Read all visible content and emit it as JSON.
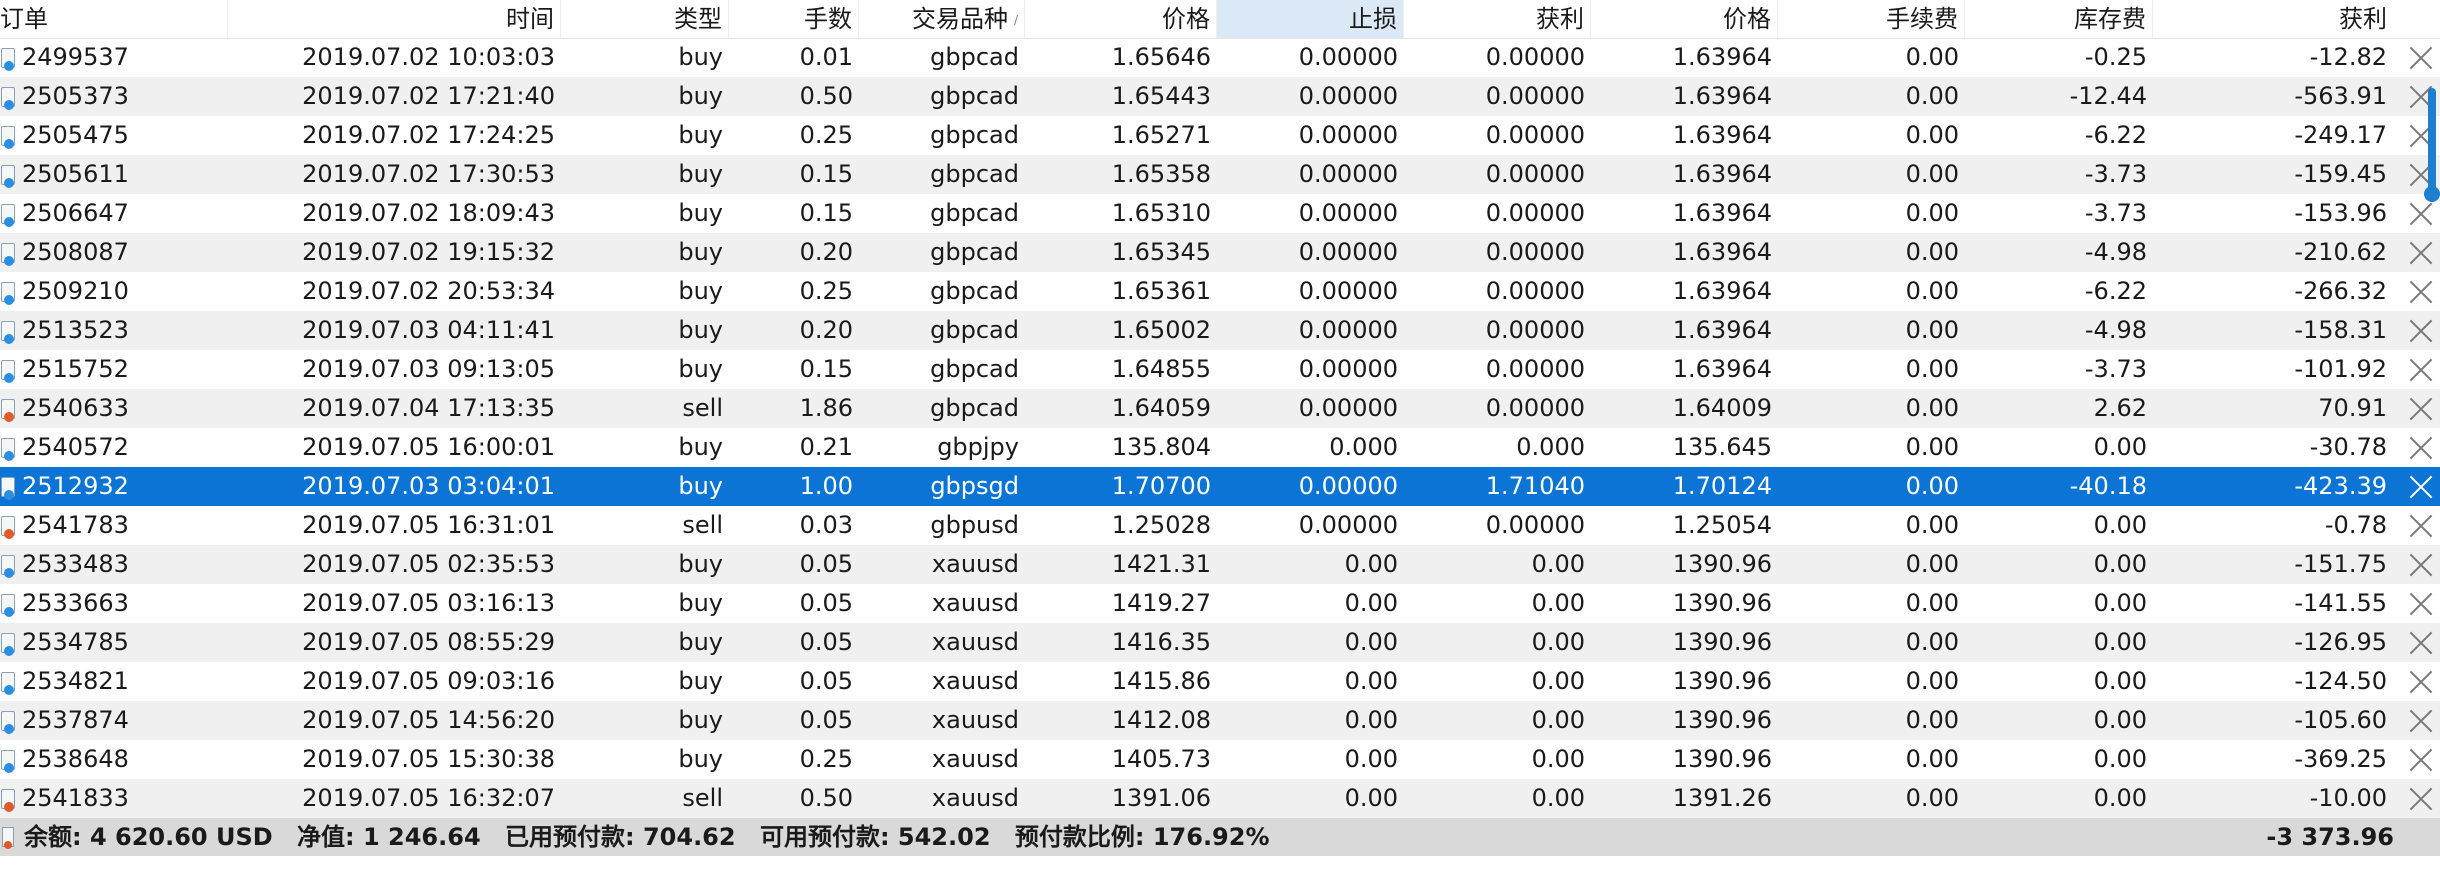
{
  "headers": {
    "order": "订单",
    "time": "时间",
    "type": "类型",
    "lots": "手数",
    "symbol": "交易品种",
    "price": "价格",
    "sl": "止损",
    "tp": "获利",
    "cur_price": "价格",
    "commission": "手续费",
    "swap": "库存费",
    "profit": "获利"
  },
  "rows": [
    {
      "order": "2499537",
      "time": "2019.07.02 10:03:03",
      "type": "buy",
      "lots": "0.01",
      "symbol": "gbpcad",
      "price": "1.65646",
      "sl": "0.00000",
      "tp": "0.00000",
      "cur_price": "1.63964",
      "commission": "0.00",
      "swap": "-0.25",
      "profit": "-12.82"
    },
    {
      "order": "2505373",
      "time": "2019.07.02 17:21:40",
      "type": "buy",
      "lots": "0.50",
      "symbol": "gbpcad",
      "price": "1.65443",
      "sl": "0.00000",
      "tp": "0.00000",
      "cur_price": "1.63964",
      "commission": "0.00",
      "swap": "-12.44",
      "profit": "-563.91"
    },
    {
      "order": "2505475",
      "time": "2019.07.02 17:24:25",
      "type": "buy",
      "lots": "0.25",
      "symbol": "gbpcad",
      "price": "1.65271",
      "sl": "0.00000",
      "tp": "0.00000",
      "cur_price": "1.63964",
      "commission": "0.00",
      "swap": "-6.22",
      "profit": "-249.17"
    },
    {
      "order": "2505611",
      "time": "2019.07.02 17:30:53",
      "type": "buy",
      "lots": "0.15",
      "symbol": "gbpcad",
      "price": "1.65358",
      "sl": "0.00000",
      "tp": "0.00000",
      "cur_price": "1.63964",
      "commission": "0.00",
      "swap": "-3.73",
      "profit": "-159.45"
    },
    {
      "order": "2506647",
      "time": "2019.07.02 18:09:43",
      "type": "buy",
      "lots": "0.15",
      "symbol": "gbpcad",
      "price": "1.65310",
      "sl": "0.00000",
      "tp": "0.00000",
      "cur_price": "1.63964",
      "commission": "0.00",
      "swap": "-3.73",
      "profit": "-153.96"
    },
    {
      "order": "2508087",
      "time": "2019.07.02 19:15:32",
      "type": "buy",
      "lots": "0.20",
      "symbol": "gbpcad",
      "price": "1.65345",
      "sl": "0.00000",
      "tp": "0.00000",
      "cur_price": "1.63964",
      "commission": "0.00",
      "swap": "-4.98",
      "profit": "-210.62"
    },
    {
      "order": "2509210",
      "time": "2019.07.02 20:53:34",
      "type": "buy",
      "lots": "0.25",
      "symbol": "gbpcad",
      "price": "1.65361",
      "sl": "0.00000",
      "tp": "0.00000",
      "cur_price": "1.63964",
      "commission": "0.00",
      "swap": "-6.22",
      "profit": "-266.32"
    },
    {
      "order": "2513523",
      "time": "2019.07.03 04:11:41",
      "type": "buy",
      "lots": "0.20",
      "symbol": "gbpcad",
      "price": "1.65002",
      "sl": "0.00000",
      "tp": "0.00000",
      "cur_price": "1.63964",
      "commission": "0.00",
      "swap": "-4.98",
      "profit": "-158.31"
    },
    {
      "order": "2515752",
      "time": "2019.07.03 09:13:05",
      "type": "buy",
      "lots": "0.15",
      "symbol": "gbpcad",
      "price": "1.64855",
      "sl": "0.00000",
      "tp": "0.00000",
      "cur_price": "1.63964",
      "commission": "0.00",
      "swap": "-3.73",
      "profit": "-101.92"
    },
    {
      "order": "2540633",
      "time": "2019.07.04 17:13:35",
      "type": "sell",
      "lots": "1.86",
      "symbol": "gbpcad",
      "price": "1.64059",
      "sl": "0.00000",
      "tp": "0.00000",
      "cur_price": "1.64009",
      "commission": "0.00",
      "swap": "2.62",
      "profit": "70.91"
    },
    {
      "order": "2540572",
      "time": "2019.07.05 16:00:01",
      "type": "buy",
      "lots": "0.21",
      "symbol": "gbpjpy",
      "price": "135.804",
      "sl": "0.000",
      "tp": "0.000",
      "cur_price": "135.645",
      "commission": "0.00",
      "swap": "0.00",
      "profit": "-30.78"
    },
    {
      "order": "2512932",
      "time": "2019.07.03 03:04:01",
      "type": "buy",
      "lots": "1.00",
      "symbol": "gbpsgd",
      "price": "1.70700",
      "sl": "0.00000",
      "tp": "1.71040",
      "cur_price": "1.70124",
      "commission": "0.00",
      "swap": "-40.18",
      "profit": "-423.39",
      "selected": true
    },
    {
      "order": "2541783",
      "time": "2019.07.05 16:31:01",
      "type": "sell",
      "lots": "0.03",
      "symbol": "gbpusd",
      "price": "1.25028",
      "sl": "0.00000",
      "tp": "0.00000",
      "cur_price": "1.25054",
      "commission": "0.00",
      "swap": "0.00",
      "profit": "-0.78"
    },
    {
      "order": "2533483",
      "time": "2019.07.05 02:35:53",
      "type": "buy",
      "lots": "0.05",
      "symbol": "xauusd",
      "price": "1421.31",
      "sl": "0.00",
      "tp": "0.00",
      "cur_price": "1390.96",
      "commission": "0.00",
      "swap": "0.00",
      "profit": "-151.75"
    },
    {
      "order": "2533663",
      "time": "2019.07.05 03:16:13",
      "type": "buy",
      "lots": "0.05",
      "symbol": "xauusd",
      "price": "1419.27",
      "sl": "0.00",
      "tp": "0.00",
      "cur_price": "1390.96",
      "commission": "0.00",
      "swap": "0.00",
      "profit": "-141.55"
    },
    {
      "order": "2534785",
      "time": "2019.07.05 08:55:29",
      "type": "buy",
      "lots": "0.05",
      "symbol": "xauusd",
      "price": "1416.35",
      "sl": "0.00",
      "tp": "0.00",
      "cur_price": "1390.96",
      "commission": "0.00",
      "swap": "0.00",
      "profit": "-126.95"
    },
    {
      "order": "2534821",
      "time": "2019.07.05 09:03:16",
      "type": "buy",
      "lots": "0.05",
      "symbol": "xauusd",
      "price": "1415.86",
      "sl": "0.00",
      "tp": "0.00",
      "cur_price": "1390.96",
      "commission": "0.00",
      "swap": "0.00",
      "profit": "-124.50"
    },
    {
      "order": "2537874",
      "time": "2019.07.05 14:56:20",
      "type": "buy",
      "lots": "0.05",
      "symbol": "xauusd",
      "price": "1412.08",
      "sl": "0.00",
      "tp": "0.00",
      "cur_price": "1390.96",
      "commission": "0.00",
      "swap": "0.00",
      "profit": "-105.60"
    },
    {
      "order": "2538648",
      "time": "2019.07.05 15:30:38",
      "type": "buy",
      "lots": "0.25",
      "symbol": "xauusd",
      "price": "1405.73",
      "sl": "0.00",
      "tp": "0.00",
      "cur_price": "1390.96",
      "commission": "0.00",
      "swap": "0.00",
      "profit": "-369.25"
    },
    {
      "order": "2541833",
      "time": "2019.07.05 16:32:07",
      "type": "sell",
      "lots": "0.50",
      "symbol": "xauusd",
      "price": "1391.06",
      "sl": "0.00",
      "tp": "0.00",
      "cur_price": "1391.26",
      "commission": "0.00",
      "swap": "0.00",
      "profit": "-10.00"
    }
  ],
  "footer": {
    "balance": "余额: 4 620.60 USD",
    "equity": "净值: 1 246.64",
    "margin": "已用预付款: 704.62",
    "free_margin": "可用预付款: 542.02",
    "margin_level": "预付款比例: 176.92%",
    "total_profit": "-3 373.96"
  },
  "colors": {
    "selected_row": "#0b74d4",
    "alt_row": "#f0f0f0",
    "footer_bg": "#d9d9d9",
    "buy_icon": "#2a8fe0",
    "sell_icon": "#e05a2a"
  },
  "icons": {
    "order_buy": "order-buy-icon",
    "order_sell": "order-sell-icon",
    "close": "close-icon"
  }
}
